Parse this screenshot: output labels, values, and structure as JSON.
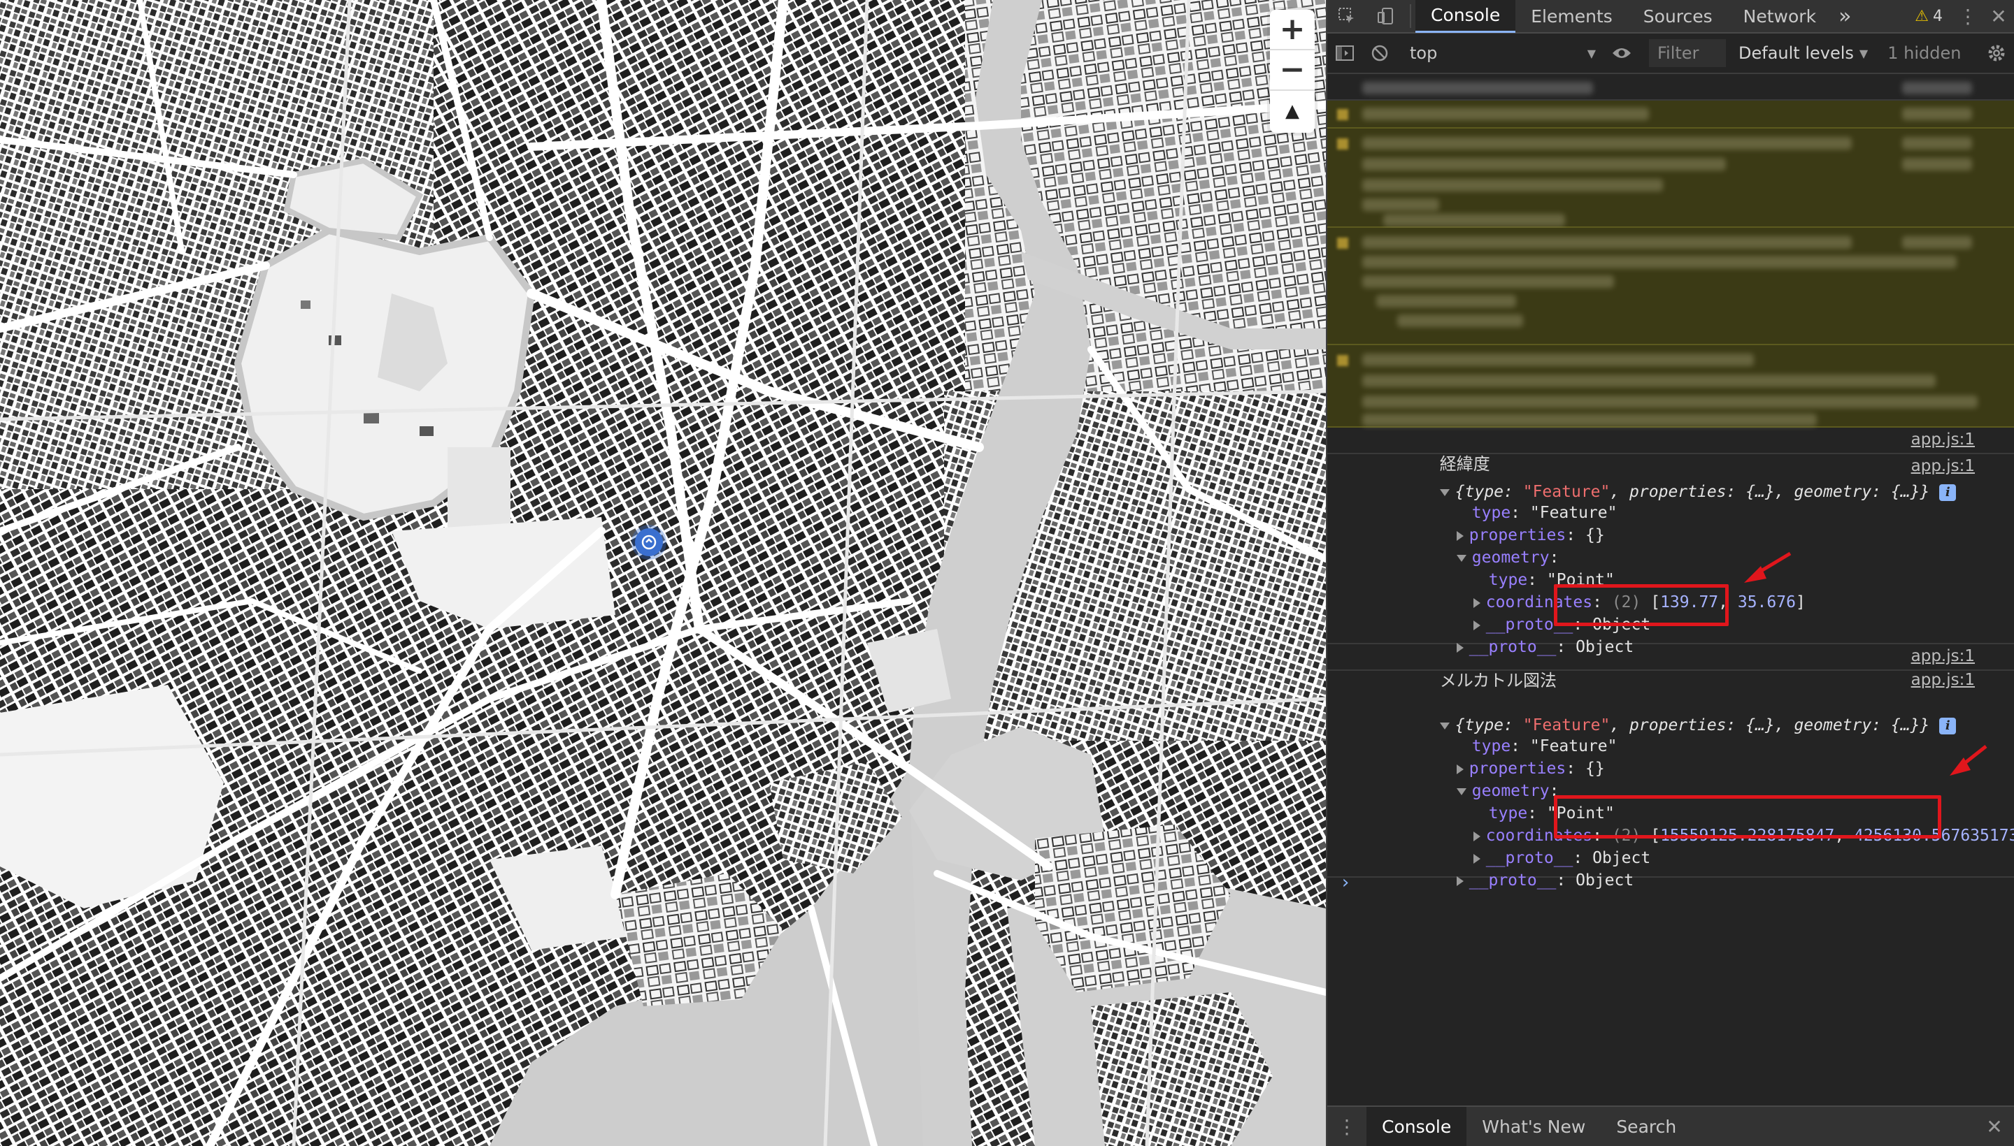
{
  "map": {
    "zoom_in": "+",
    "zoom_out": "−",
    "compass": "▲",
    "marker_color": "#3a6fcf"
  },
  "devtools": {
    "tabs": [
      "Console",
      "Elements",
      "Sources",
      "Network"
    ],
    "more_tabs": "»",
    "warning_count": "4",
    "context": "top",
    "filter_placeholder": "Filter",
    "levels": "Default levels",
    "hidden_count": "1 hidden",
    "messages": {
      "lonlat_label": "経緯度",
      "lonlat_source": "app.js:1",
      "lonlat_object_source": "app.js:1",
      "mercator_label": "メルカトル図法",
      "mercator_source": "app.js:1",
      "mercator_object_source": "app.js:1",
      "summary_open": "{",
      "summary_type_key": "type",
      "summary_type_value": "\"Feature\"",
      "summary_rest": ", properties: {…}, geometry: {…}}",
      "type_key": "type",
      "type_value": "\"Feature\"",
      "properties_key": "properties",
      "properties_value": "{}",
      "geometry_key": "geometry",
      "geom_type_key": "type",
      "geom_type_value": "\"Point\"",
      "coordinates_key": "coordinates",
      "coordinates_len": "(2)",
      "proto_key": "__proto__",
      "proto_value": "Object",
      "lonlat_coords": [
        "139.77",
        "35.676"
      ],
      "mercator_coords": [
        "15559125.228175847",
        "4256130.567635173"
      ]
    },
    "bottom_tabs": [
      "Console",
      "What's New",
      "Search"
    ],
    "colors": {
      "accent": "#8ab4f8",
      "highlight_box": "#e0161c",
      "warning_bg": "#3b3a15"
    }
  }
}
